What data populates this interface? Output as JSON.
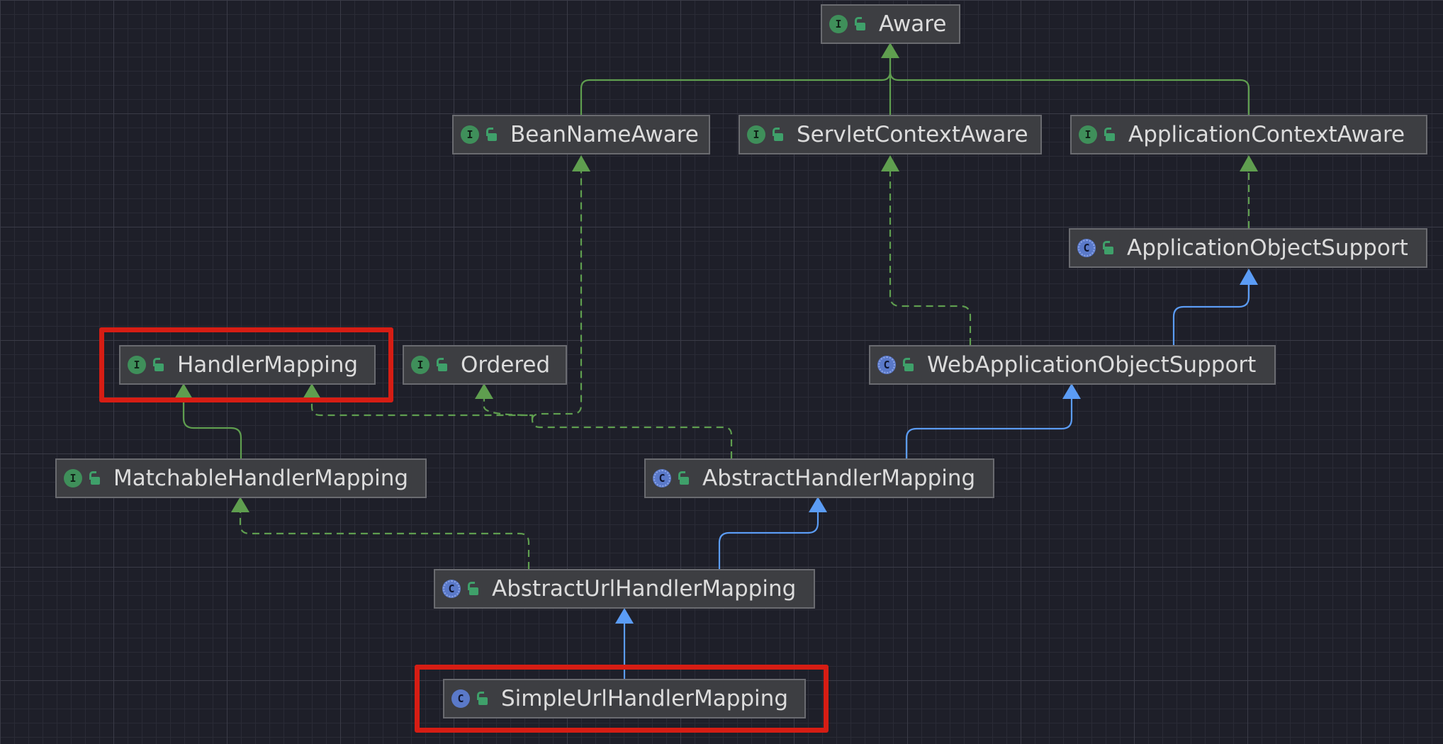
{
  "nodes": {
    "aware": {
      "label": "Aware",
      "kind": "I"
    },
    "bean": {
      "label": "BeanNameAware",
      "kind": "I"
    },
    "servlet": {
      "label": "ServletContextAware",
      "kind": "I"
    },
    "appctx": {
      "label": "ApplicationContextAware",
      "kind": "I"
    },
    "appobj": {
      "label": "ApplicationObjectSupport",
      "kind": "C"
    },
    "handler": {
      "label": "HandlerMapping",
      "kind": "I"
    },
    "ordered": {
      "label": "Ordered",
      "kind": "I"
    },
    "webappobj": {
      "label": "WebApplicationObjectSupport",
      "kind": "C"
    },
    "matchable": {
      "label": "MatchableHandlerMapping",
      "kind": "I"
    },
    "abstracthm": {
      "label": "AbstractHandlerMapping",
      "kind": "C"
    },
    "abstracturl": {
      "label": "AbstractUrlHandlerMapping",
      "kind": "C"
    },
    "simpleurl": {
      "label": "SimpleUrlHandlerMapping",
      "kind": "C"
    }
  },
  "colors": {
    "interface_edge": "#5f9e4f",
    "class_edge": "#5b9cf5",
    "highlight": "#d61d14"
  }
}
